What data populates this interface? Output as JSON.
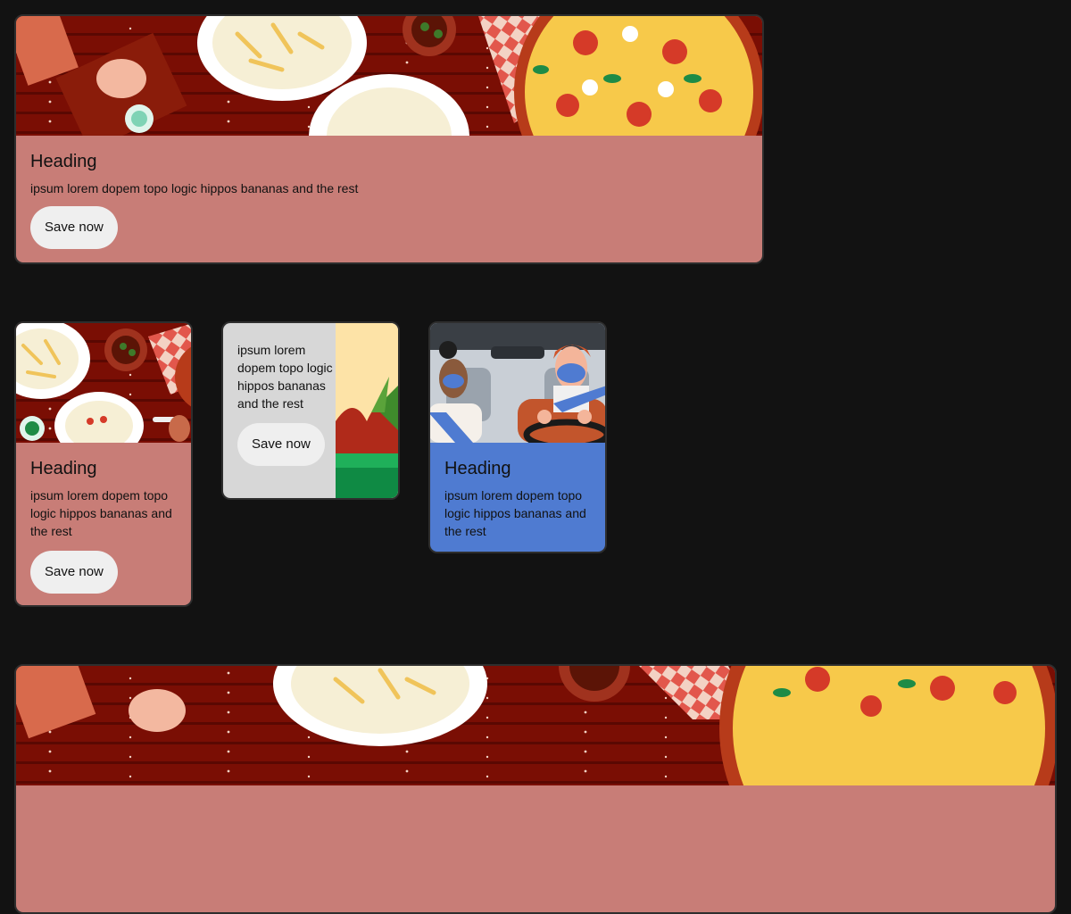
{
  "cards": [
    {
      "heading": "Heading",
      "text": "ipsum lorem dopem topo logic hippos bananas and the rest",
      "button": "Save now",
      "image": "pizza-pasta-table-illustration"
    },
    {
      "heading": "Heading",
      "text": "ipsum lorem dopem topo logic hippos bananas and the rest",
      "button": "Save now",
      "image": "pasta-table-illustration"
    },
    {
      "text": "ipsum lorem dopem topo logic hippos bananas and the rest",
      "button": "Save now",
      "image": "plant-pot-illustration"
    },
    {
      "heading": "Heading",
      "text": "ipsum lorem dopem topo logic hippos bananas and the rest",
      "image": "masked-people-in-car-illustration"
    },
    {
      "image": "pizza-pasta-table-illustration"
    }
  ],
  "colors": {
    "page_background": "#121212",
    "card_salmon": "#c87d77",
    "card_grey": "#d7d7d7",
    "card_blue": "#4f7bd1",
    "button": "#efefef"
  }
}
